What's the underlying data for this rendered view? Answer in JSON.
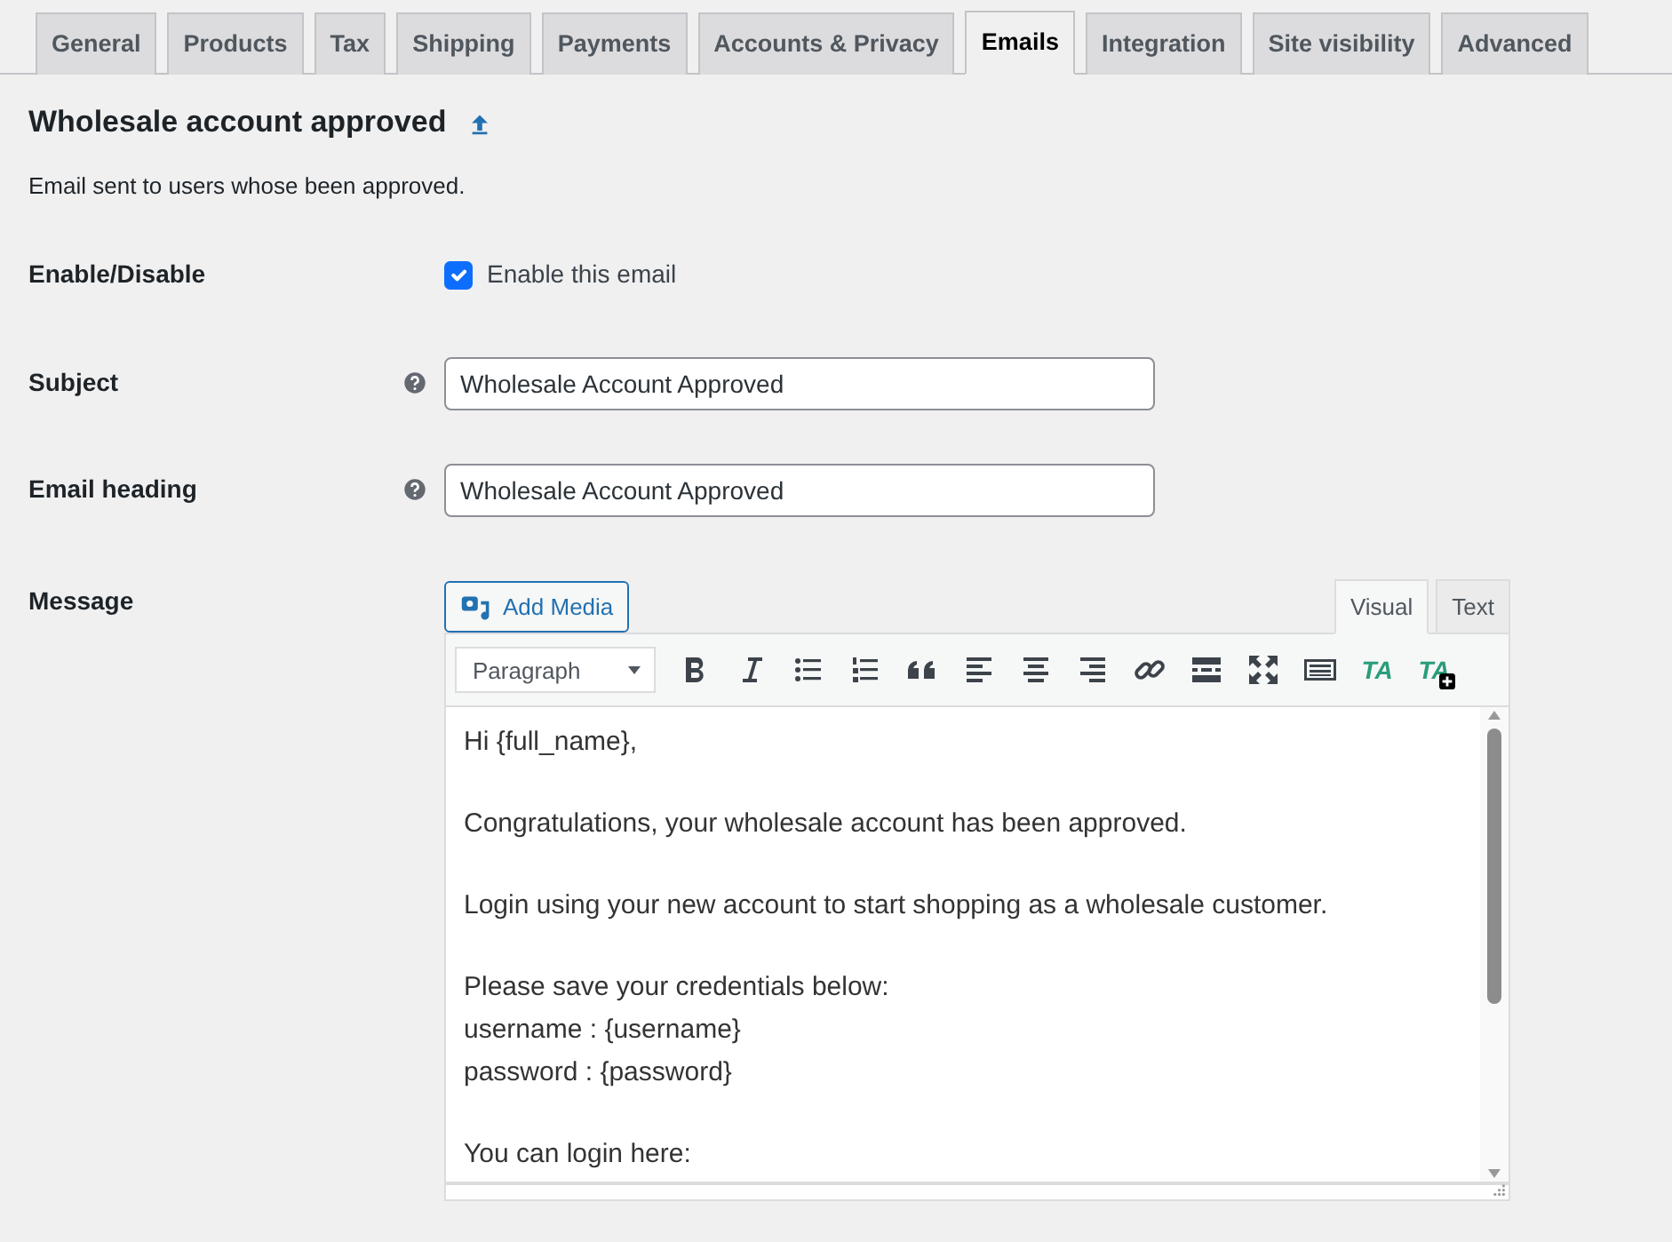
{
  "tabs": [
    {
      "label": "General",
      "selected": false
    },
    {
      "label": "Products",
      "selected": false
    },
    {
      "label": "Tax",
      "selected": false
    },
    {
      "label": "Shipping",
      "selected": false
    },
    {
      "label": "Payments",
      "selected": false
    },
    {
      "label": "Accounts & Privacy",
      "selected": false
    },
    {
      "label": "Emails",
      "selected": true
    },
    {
      "label": "Integration",
      "selected": false
    },
    {
      "label": "Site visibility",
      "selected": false
    },
    {
      "label": "Advanced",
      "selected": false
    }
  ],
  "heading": "Wholesale account approved",
  "description": "Email sent to users whose been approved.",
  "fields": [
    {
      "kind": "checkbox",
      "label": "Enable/Disable",
      "text": "Enable this email",
      "checked": true
    },
    {
      "kind": "text",
      "label": "Subject",
      "value": "Wholesale Account Approved",
      "help": true
    },
    {
      "kind": "text",
      "label": "Email heading",
      "value": "Wholesale Account Approved",
      "help": true
    }
  ],
  "message": {
    "label": "Message",
    "add_media": "Add Media",
    "modes": [
      {
        "label": "Visual",
        "selected": true
      },
      {
        "label": "Text",
        "selected": false
      }
    ],
    "format": "Paragraph",
    "toolbar": [
      {
        "kind": "icon"
      },
      {
        "kind": "icon"
      },
      {
        "kind": "icon"
      },
      {
        "kind": "icon"
      },
      {
        "kind": "icon"
      },
      {
        "kind": "icon"
      },
      {
        "kind": "icon"
      },
      {
        "kind": "icon"
      },
      {
        "kind": "icon"
      },
      {
        "kind": "icon"
      },
      {
        "kind": "icon"
      },
      {
        "kind": "icon"
      },
      {
        "kind": "text",
        "text": "TA",
        "plus": false
      },
      {
        "kind": "text",
        "text": "TA",
        "plus": true
      }
    ],
    "paragraphs": [
      [
        "Hi {full_name},"
      ],
      [
        "Congratulations, your wholesale account has been approved."
      ],
      [
        "Login using your new account to start shopping as a wholesale customer."
      ],
      [
        "Please save your credentials below:",
        "username : {username}",
        "password : {password}"
      ],
      [
        "You can login here:"
      ]
    ]
  }
}
